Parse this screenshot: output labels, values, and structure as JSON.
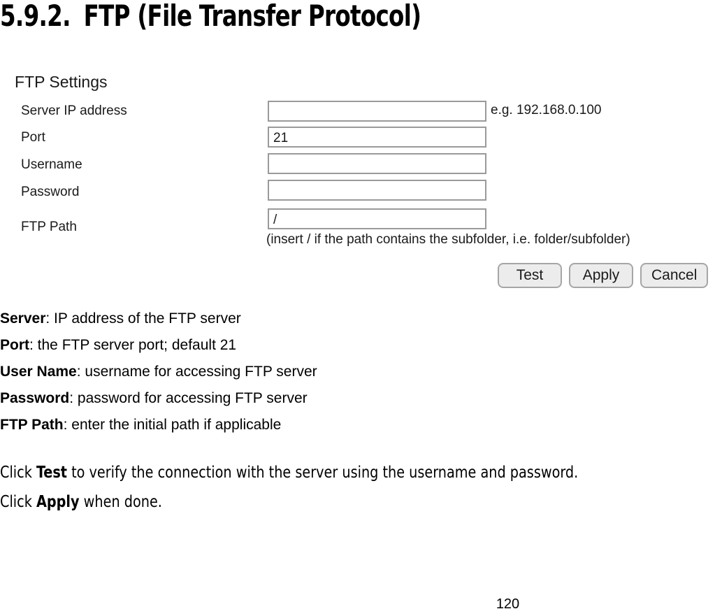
{
  "heading": {
    "number": "5.9.2.",
    "title": "FTP (File Transfer Protocol)"
  },
  "ui": {
    "panel_title": "FTP Settings",
    "fields": [
      {
        "label": "Server IP address",
        "value": "",
        "hint": "e.g. 192.168.0.100"
      },
      {
        "label": "Port",
        "value": "21",
        "hint": ""
      },
      {
        "label": "Username",
        "value": "",
        "hint": ""
      },
      {
        "label": "Password",
        "value": "",
        "hint": ""
      },
      {
        "label": "FTP Path",
        "value": "/",
        "hint": "(insert / if the path contains the subfolder, i.e. folder/subfolder)"
      }
    ],
    "buttons": [
      {
        "label": "Test"
      },
      {
        "label": "Apply"
      },
      {
        "label": "Cancel"
      }
    ],
    "colors": {
      "field_border": "#9a9a9a",
      "button_face": "#ececec",
      "button_border": "#a6a6a6"
    }
  },
  "descriptions": [
    {
      "term": "Server",
      "text": ": IP address of the FTP server"
    },
    {
      "term": "Port",
      "text": ": the FTP server port; default 21"
    },
    {
      "term": "User Name",
      "text": ": username for accessing FTP server"
    },
    {
      "term": "Password",
      "text": ": password for accessing FTP server"
    },
    {
      "term": "FTP Path",
      "text": ": enter the initial path if applicable"
    }
  ],
  "instructions": [
    {
      "prefix": "Click ",
      "bold": "Test",
      "suffix": " to verify the connection with the server using the username and password."
    },
    {
      "prefix": "Click ",
      "bold": "Apply",
      "suffix": " when done."
    }
  ],
  "footer": {
    "page_number": "120"
  }
}
